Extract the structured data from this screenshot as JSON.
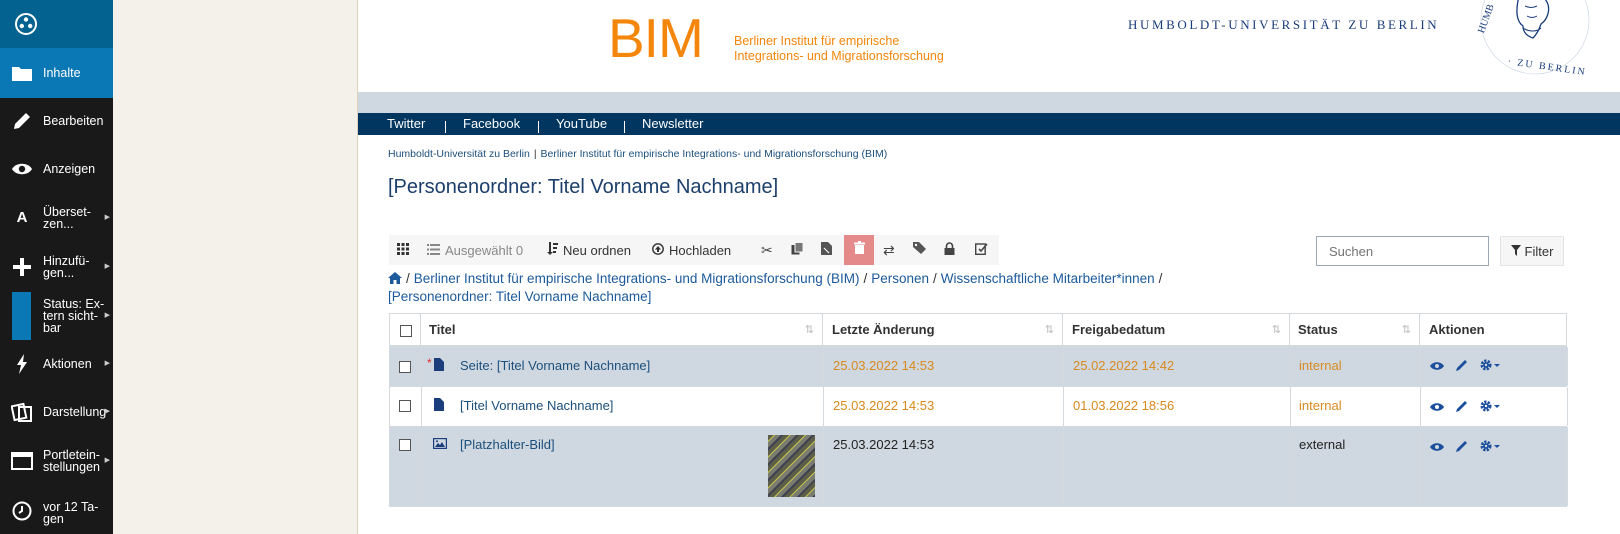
{
  "toolbar": {
    "items": [
      {
        "label": "Inhalte",
        "icon": "folder-icon"
      },
      {
        "label": "Bearbeiten",
        "icon": "pencil-icon"
      },
      {
        "label": "Anzeigen",
        "icon": "eye-icon"
      },
      {
        "label": "Überset-zen...",
        "icon": "translate-icon"
      },
      {
        "label": "Hinzufü-gen...",
        "icon": "plus-icon"
      },
      {
        "label": "Status: Ex-tern sicht-bar",
        "icon": "status-icon"
      },
      {
        "label": "Aktionen",
        "icon": "bolt-icon"
      },
      {
        "label": "Darstellung",
        "icon": "display-icon"
      },
      {
        "label": "Portletein-stellungen",
        "icon": "portlet-icon"
      },
      {
        "label": "vor 12 Ta-gen",
        "icon": "clock-icon"
      }
    ]
  },
  "header": {
    "logo_text": "BIM",
    "logo_sub_1": "Berliner Institut für empirische",
    "logo_sub_2": "Integrations- und Migrationsforschung",
    "university": "HUMBOLDT-UNIVERSITÄT ZU BERLIN",
    "seal_text": "HUMBOLDT · ZU BERLIN"
  },
  "nav": [
    "Twitter",
    "Facebook",
    "YouTube",
    "Newsletter"
  ],
  "breadcrumb_top": [
    "Humboldt-Universität zu Berlin",
    "Berliner Institut für empirische Integrations- und Migrationsforschung (BIM)"
  ],
  "page_title": "[Personenordner: Titel Vorname Nachname]",
  "actionbar": {
    "selected": "Ausgewählt 0",
    "reorder": "Neu ordnen",
    "upload": "Hochladen"
  },
  "search": {
    "placeholder": "Suchen"
  },
  "filter_label": "Filter",
  "path": {
    "segments": [
      "Berliner Institut für empirische Integrations- und Migrationsforschung (BIM)",
      "Personen",
      "Wissenschaftliche Mitarbeiter*innen"
    ],
    "current": "[Personenordner: Titel Vorname Nachname]"
  },
  "table": {
    "headers": [
      "Titel",
      "Letzte Änderung",
      "Freigabedatum",
      "Status",
      "Aktionen"
    ],
    "rows": [
      {
        "marker": "*",
        "title": "Seite: [Titel Vorname Nachname]",
        "modified": "25.03.2022 14:53",
        "published": "25.02.2022 14:42",
        "status": "internal"
      },
      {
        "marker": "",
        "title": "[Titel Vorname Nachname]",
        "modified": "25.03.2022 14:53",
        "published": "01.03.2022 18:56",
        "status": "internal"
      },
      {
        "marker": "",
        "title": "[Platzhalter-Bild]",
        "modified": "25.03.2022 14:53",
        "published": "",
        "status": "external"
      }
    ]
  },
  "colors": {
    "toolbar_bg": "#191919",
    "toolbar_active": "#0b78b6",
    "brand_orange": "#f3860b",
    "nav_bg": "#00365f",
    "link": "#1c4f7b",
    "status_orange": "#d9891d"
  }
}
